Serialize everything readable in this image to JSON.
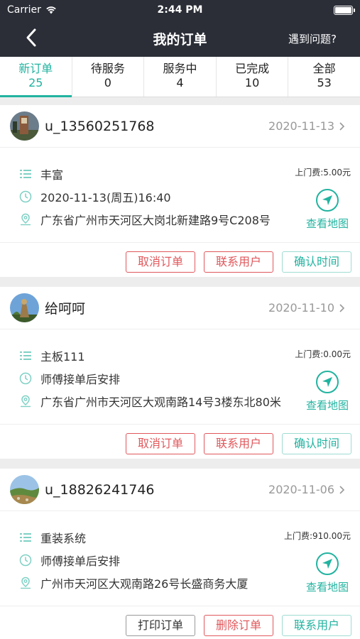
{
  "status_bar": {
    "carrier": "Carrier",
    "time": "2:44 PM"
  },
  "nav": {
    "title": "我的订单",
    "help": "遇到问题?"
  },
  "tabs": [
    {
      "label": "新订单",
      "count": "25",
      "active": true
    },
    {
      "label": "待服务",
      "count": "0"
    },
    {
      "label": "服务中",
      "count": "4"
    },
    {
      "label": "已完成",
      "count": "10"
    },
    {
      "label": "全部",
      "count": "53"
    }
  ],
  "orders": [
    {
      "username": "u_13560251768",
      "date": "2020-11-13",
      "service": "丰富",
      "fee": "上门费:5.00元",
      "time": "2020-11-13(周五)16:40",
      "address": "广东省广州市天河区大岗北新建路9号C208号",
      "map": "查看地图",
      "buttons": [
        "取消订单",
        "联系用户",
        "确认时间"
      ]
    },
    {
      "username": "给呵呵",
      "date": "2020-11-10",
      "service": "主板111",
      "fee": "上门费:0.00元",
      "time": "师傅接单后安排",
      "address": "广东省广州市天河区大观南路14号3楼东北80米",
      "map": "查看地图",
      "buttons": [
        "取消订单",
        "联系用户",
        "确认时间"
      ]
    },
    {
      "username": "u_18826241746",
      "date": "2020-11-06",
      "service": "重装系统",
      "fee": "上门费:910.00元",
      "time": "师傅接单后安排",
      "address": "广州市天河区大观南路26号长盛商务大厦",
      "map": "查看地图",
      "buttons": [
        "打印订单",
        "删除订单",
        "联系用户"
      ]
    }
  ],
  "colors": {
    "accent": "#22b3a0",
    "danger": "#e0585c",
    "navbar": "#2b2e37"
  }
}
